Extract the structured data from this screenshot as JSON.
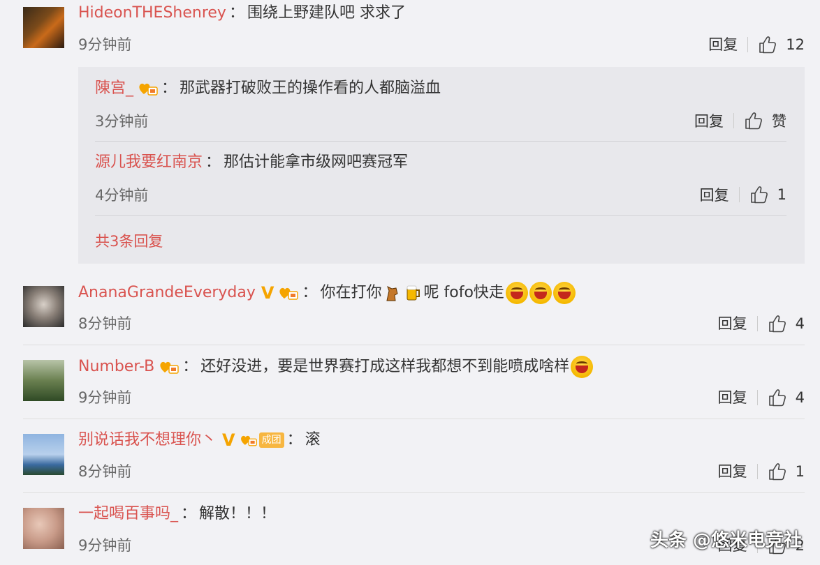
{
  "comments": [
    {
      "username": "HideonTHEShenrey",
      "text": "围绕上野建队吧 求求了",
      "time": "9分钟前",
      "reply_label": "回复",
      "likes": "12"
    },
    {
      "username": "AnanaGrandeEveryday",
      "text_a": "你在打你",
      "text_b": "呢 fofo快走",
      "time": "8分钟前",
      "reply_label": "回复",
      "likes": "4"
    },
    {
      "username": "Number-B",
      "text": "还好没进，要是世界赛打成这样我都想不到能喷成啥样",
      "time": "9分钟前",
      "reply_label": "回复",
      "likes": "4"
    },
    {
      "username": "别说话我不想理你丶",
      "fan_label": "成团",
      "text": "滚",
      "time": "8分钟前",
      "reply_label": "回复",
      "likes": "1"
    },
    {
      "username": "一起喝百事吗_",
      "text": "解散！！！",
      "time": "9分钟前",
      "reply_label": "回复",
      "likes": "2"
    }
  ],
  "replies": [
    {
      "username": "陳宫_",
      "text": "那武器打破败王的操作看的人都脑溢血",
      "time": "3分钟前",
      "reply_label": "回复",
      "likes": "赞"
    },
    {
      "username": "源儿我要红南京",
      "text": "那估计能拿市级网吧赛冠军",
      "time": "4分钟前",
      "reply_label": "回复",
      "likes": "1"
    }
  ],
  "more_replies": "共3条回复",
  "watermark": "头条 @悠米电竞社",
  "colors": {
    "username": "#d9534f",
    "badge": "#f5a400",
    "background": "#f2f2f5"
  }
}
